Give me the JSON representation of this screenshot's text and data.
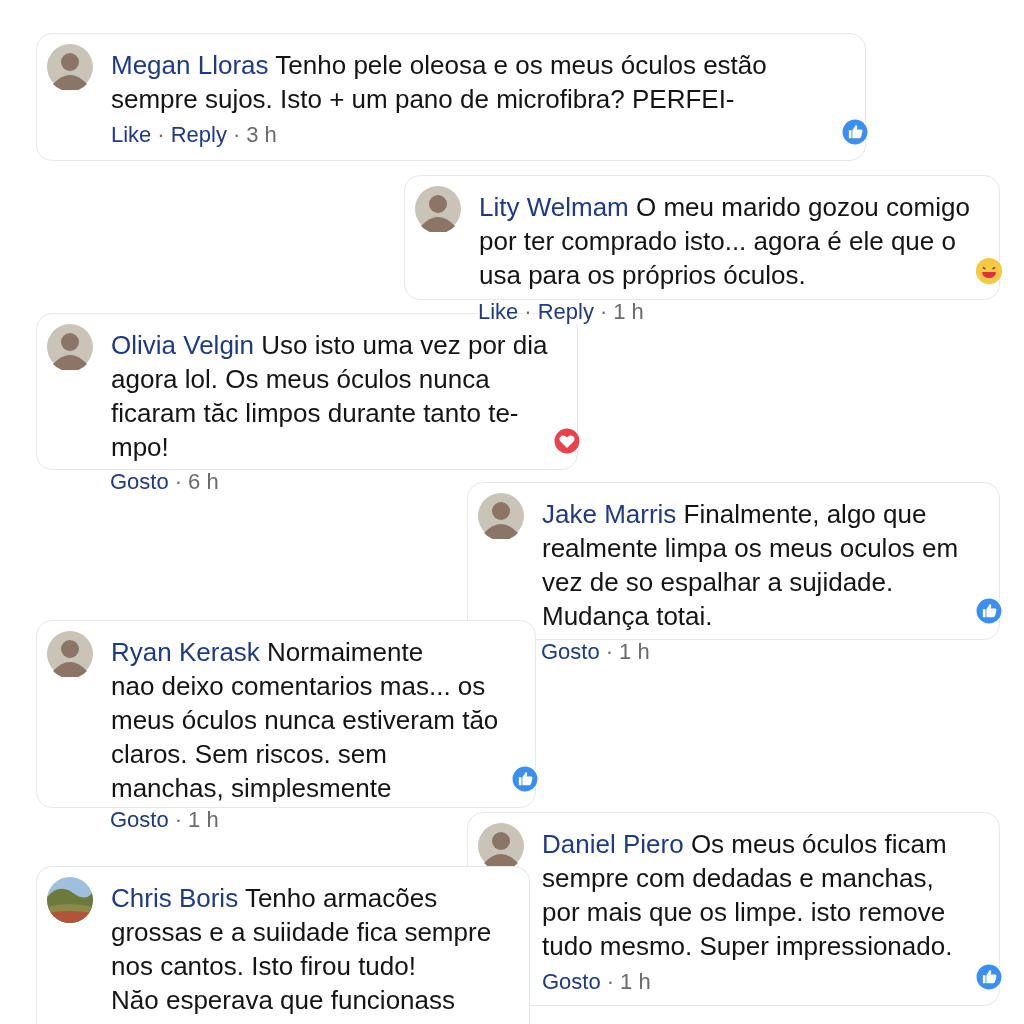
{
  "separator": "·",
  "comments": [
    {
      "author": "Megan Lloras",
      "avatar": {
        "kind": "person"
      },
      "text": "Tenho pele oleosa e os meus óculos estão sempre sujos. Isto + um pano de microfibra? PERFEI-",
      "actions": [
        {
          "kind": "link",
          "label": "Like"
        },
        {
          "kind": "link",
          "label": "Reply"
        },
        {
          "kind": "time",
          "label": "3 h"
        }
      ],
      "reaction": {
        "kind": "like"
      }
    },
    {
      "author": "Lity Welmam",
      "avatar": {
        "kind": "person"
      },
      "text": "O meu marido gozou comigo por ter comprado isto... agora é ele que o usa para os próprios óculos.",
      "actions": [
        {
          "kind": "link",
          "label": "Like"
        },
        {
          "kind": "link",
          "label": "Reply"
        },
        {
          "kind": "time",
          "label": "1 h"
        }
      ],
      "reaction": {
        "kind": "haha"
      }
    },
    {
      "author": "Olivia Velgin",
      "avatar": {
        "kind": "person"
      },
      "text": "Uso isto uma vez por dia agora lol. Os meus óculos nunca ficaram tăc limpos durante tanto te-mpo!",
      "actions": [
        {
          "kind": "link",
          "label": "Gosto"
        },
        {
          "kind": "time",
          "label": "6 h"
        }
      ],
      "reaction": {
        "kind": "heart"
      }
    },
    {
      "author": "Jake Marris",
      "avatar": {
        "kind": "person"
      },
      "text": "Finalmente, algo que realmente limpa os meus oculos em vez de so espalhar a sujidade. Mudança totai.",
      "actions": [
        {
          "kind": "link",
          "label": "Gosto"
        },
        {
          "kind": "time",
          "label": "1 h"
        }
      ],
      "reaction": {
        "kind": "like"
      }
    },
    {
      "author": "Ryan Kerask",
      "avatar": {
        "kind": "person"
      },
      "text": "Normaimente\nnao deixo comentarios mas... os meus óculos nunca estiveram tăo claros. Sem riscos. sem manchas, simplesmente",
      "actions": [
        {
          "kind": "link",
          "label": "Gosto"
        },
        {
          "kind": "time",
          "label": "1 h"
        }
      ],
      "reaction": {
        "kind": "like"
      }
    },
    {
      "author": "Daniel Piero",
      "avatar": {
        "kind": "person"
      },
      "text": "Os meus óculos ficam sempre com dedadas e manchas, por mais que os limpe. isto remove tudo mesmo. Super impressionado.",
      "actions": [
        {
          "kind": "link",
          "label": "Gosto"
        },
        {
          "kind": "time",
          "label": "1 h"
        }
      ],
      "reaction": {
        "kind": "like"
      }
    },
    {
      "author": "Chris Boris",
      "text": "Tenho armacões grossas e a suiidade fica sempre nos cantos. Isto firou tudo!\nNăo esperava que funcionass"
    }
  ]
}
